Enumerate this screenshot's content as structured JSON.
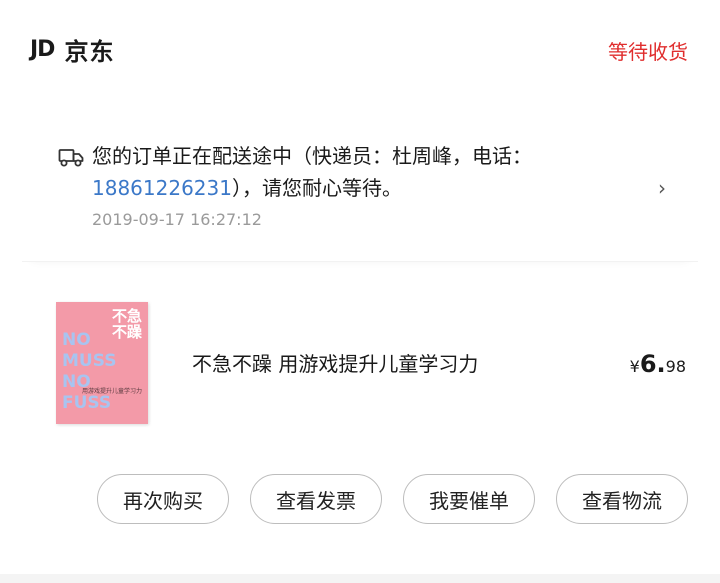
{
  "shop": {
    "logo": "JD",
    "name": "京东"
  },
  "order": {
    "status": "等待收货"
  },
  "logistics": {
    "icon": "truck-icon",
    "message_prefix": "您的订单正在配送途中（快递员：杜周峰，电话：",
    "phone": "18861226231",
    "message_suffix": "），请您耐心等待。",
    "time": "2019-09-17 16:27:12",
    "chevron": "›"
  },
  "product": {
    "name": "不急不躁 用游戏提升儿童学习力",
    "price_currency": "¥",
    "price_integer": "6.",
    "price_decimal": "98",
    "cover": {
      "title_line1": "不急",
      "title_line2": "不躁",
      "big_text": "NO\nMUSS\nNO\nFUSS",
      "subtitle": "用游戏提升儿童学习力",
      "color": "#f39aa8"
    }
  },
  "actions": {
    "buy_again": "再次购买",
    "view_invoice": "查看发票",
    "urge_order": "我要催单",
    "view_logistics": "查看物流"
  },
  "colors": {
    "status_red": "#e02d2d",
    "phone_blue": "#3b78c8",
    "time_gray": "#9a9a9a"
  }
}
